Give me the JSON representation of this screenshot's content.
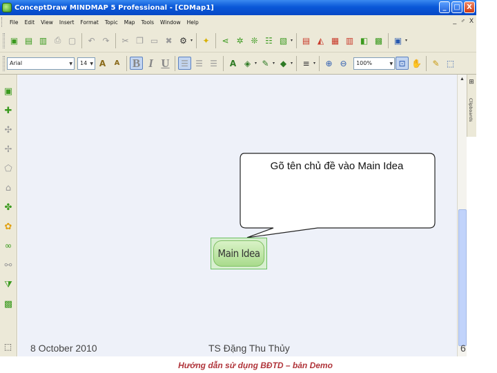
{
  "window": {
    "title": "ConceptDraw MINDMAP 5 Professional - [CDMap1]",
    "buttons": [
      "_",
      "□",
      "X"
    ]
  },
  "menu": {
    "items": [
      "File",
      "Edit",
      "View",
      "Insert",
      "Format",
      "Topic",
      "Map",
      "Tools",
      "Window",
      "Help"
    ],
    "mdi_controls": [
      "_",
      "♂",
      "X"
    ]
  },
  "format_toolbar": {
    "font_name": "Arial",
    "font_size": "14",
    "zoom": "100%"
  },
  "right_panel": {
    "tab_label": "Clipboards"
  },
  "canvas": {
    "callout_text": "Gõ tên chủ đề vào Main Idea",
    "main_idea_label": "Main Idea"
  },
  "slide_footer": {
    "date": "8 October 2010",
    "author": "TS Đặng Thu Thủy",
    "page": "6",
    "caption": "Hướng dẫn sử dụng BĐTD – bản Demo"
  },
  "colors": {
    "titlebar": "#0a58d8",
    "node_fill": "#b8e3a0",
    "canvas_bg": "#eef1f9",
    "caption": "#b0343a"
  }
}
